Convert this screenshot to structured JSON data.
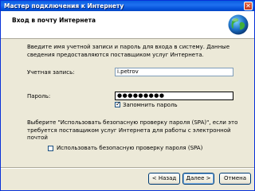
{
  "window": {
    "title": "Мастер подключения к Интернету",
    "close_glyph": "✕"
  },
  "header": {
    "title": "Вход в почту Интернета",
    "icon": "globe-icon"
  },
  "description": "Введите имя учетной записи и пароль для входа в систему. Данные сведения предоставляются поставщиком услуг Интернета.",
  "account": {
    "label": "Учетная запись:",
    "value": "i.petrov"
  },
  "password": {
    "label": "Пароль:",
    "value": "●●●●●●●●●",
    "remember_label": "Запомнить пароль",
    "remember_checked": true,
    "check_glyph": "✓"
  },
  "spa": {
    "text": "Выберите \"Использовать безопасную проверку пароля (SPA)\", если это требуется поставщиком услуг Интернета для работы с электронной почтой",
    "checkbox_label": "Использовать безопасную проверку пароля (SPA)",
    "checked": false
  },
  "buttons": {
    "back": "< Назад",
    "next": "Далее >",
    "cancel": "Отмена"
  },
  "colors": {
    "titlebar": "#0a5ee0",
    "dialog_bg": "#ece9d8"
  }
}
